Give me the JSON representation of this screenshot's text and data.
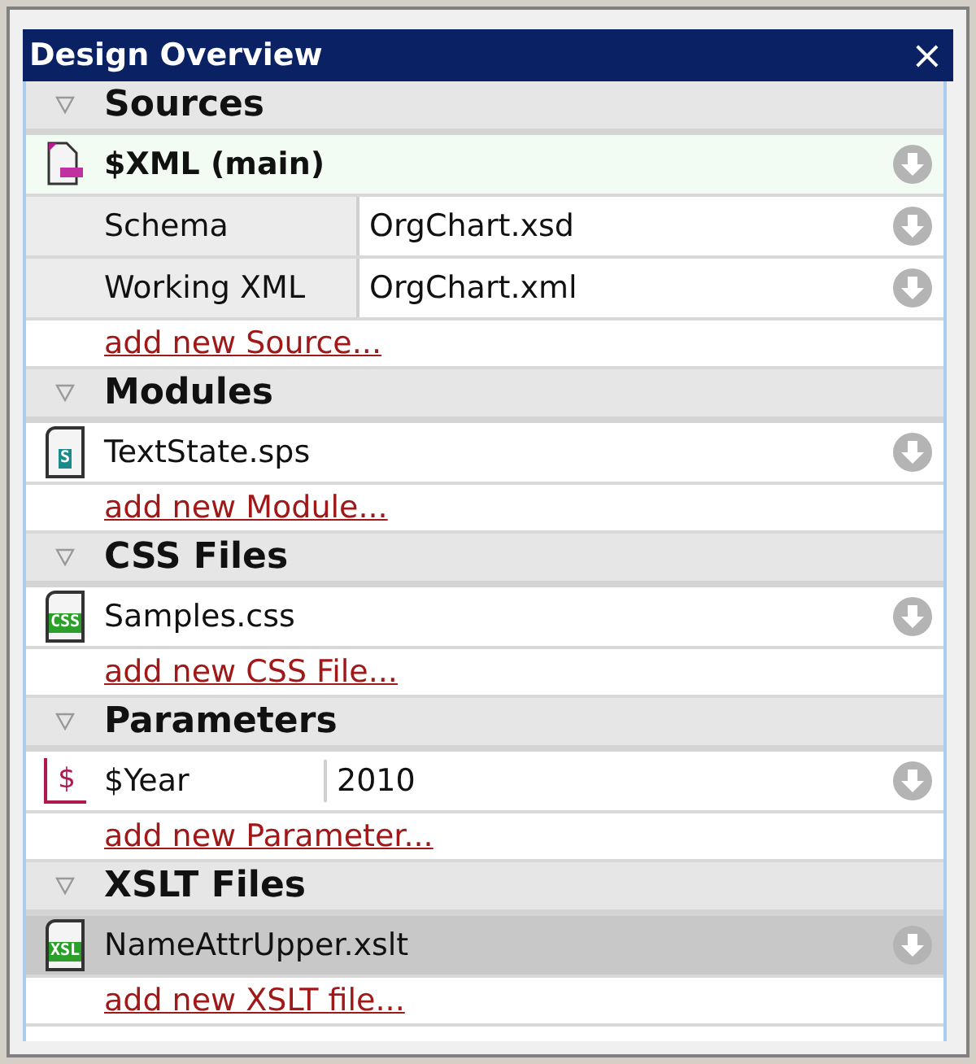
{
  "window": {
    "title": "Design Overview",
    "close": "×"
  },
  "sections": [
    {
      "title": "Sources",
      "expanded": true,
      "items": [
        {
          "kind": "main",
          "name": "$XML (main)",
          "selected": false
        },
        {
          "kind": "property",
          "name": "Schema",
          "value": "OrgChart.xsd",
          "selected": false
        },
        {
          "kind": "property",
          "name": "Working XML",
          "value": "OrgChart.xml",
          "selected": false
        }
      ],
      "add_link": "add new Source..."
    },
    {
      "title": "Modules",
      "expanded": true,
      "items": [
        {
          "kind": "module",
          "badge": "S",
          "name": "TextState.sps",
          "selected": false
        }
      ],
      "add_link": "add new Module..."
    },
    {
      "title": "CSS Files",
      "expanded": true,
      "items": [
        {
          "kind": "stylesheet",
          "badge": "CSS",
          "name": "Samples.css",
          "selected": false
        }
      ],
      "add_link": "add new CSS File..."
    },
    {
      "title": "Parameters",
      "expanded": true,
      "items": [
        {
          "kind": "parameter",
          "badge": "$",
          "name": "$Year",
          "value": "2010",
          "selected": false
        }
      ],
      "add_link": "add new Parameter..."
    },
    {
      "title": "XSLT Files",
      "expanded": true,
      "items": [
        {
          "kind": "transform",
          "badge": "XSL",
          "name": "NameAttrUpper.xslt",
          "selected": true
        }
      ],
      "add_link": "add new XSLT file..."
    }
  ]
}
